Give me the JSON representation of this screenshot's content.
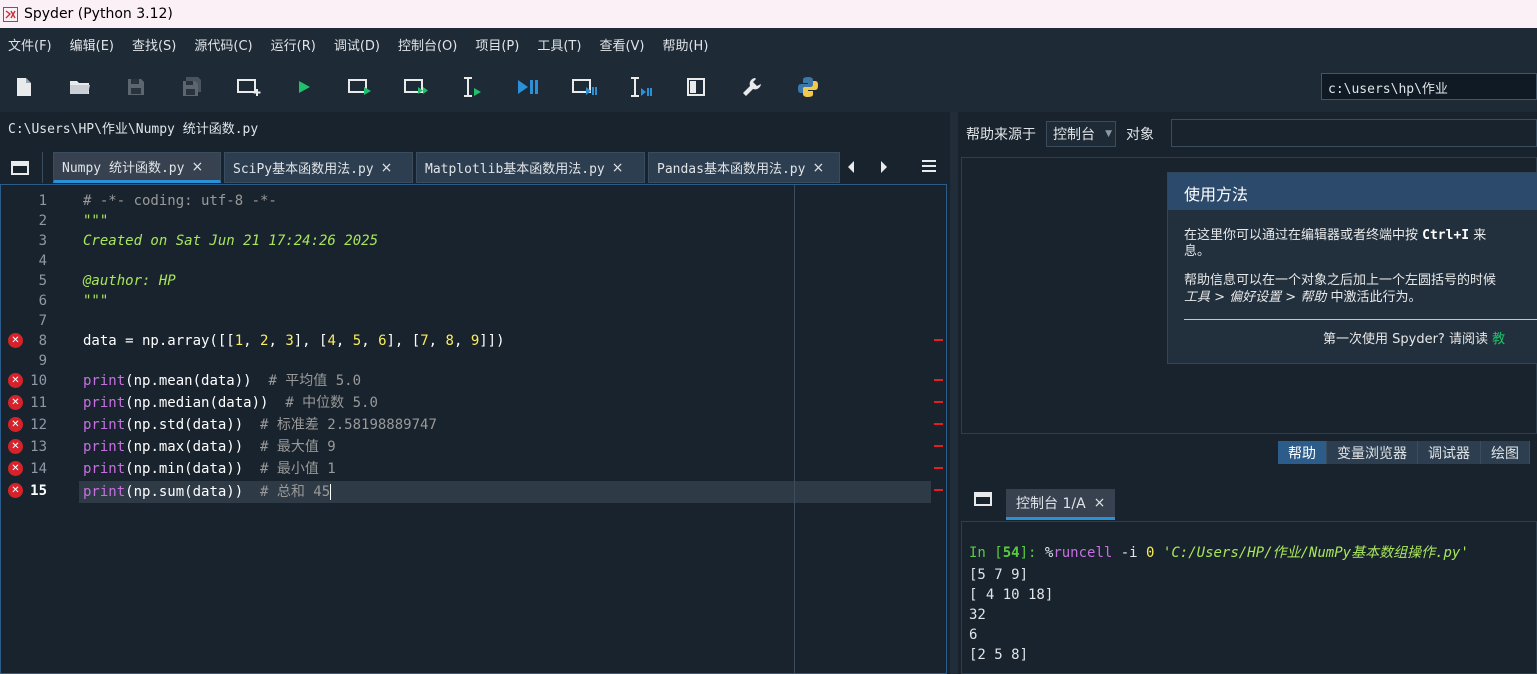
{
  "window": {
    "title": "Spyder (Python 3.12)"
  },
  "menu": [
    "文件(F)",
    "编辑(E)",
    "查找(S)",
    "源代码(C)",
    "运行(R)",
    "调试(D)",
    "控制台(O)",
    "项目(P)",
    "工具(T)",
    "查看(V)",
    "帮助(H)"
  ],
  "toolbar": {
    "icons": [
      "new-file-icon",
      "open-folder-icon",
      "save-icon",
      "save-all-icon",
      "new-cell-icon",
      "run-icon",
      "run-cell-icon",
      "run-cell-advance-icon",
      "run-selection-icon",
      "debug-icon",
      "debug-cell-icon",
      "debug-selection-icon",
      "maximize-pane-icon",
      "preferences-wrench-icon",
      "python-path-icon"
    ],
    "cwd": "c:\\users\\hp\\作业"
  },
  "editor": {
    "filepath": "C:\\Users\\HP\\作业\\Numpy 统计函数.py",
    "tabs": [
      "Numpy 统计函数.py",
      "SciPy基本函数用法.py",
      "Matplotlib基本函数用法.py",
      "Pandas基本函数用法.py"
    ],
    "line_numbers": [
      "1",
      "2",
      "3",
      "4",
      "5",
      "6",
      "7",
      "8",
      "9",
      "10",
      "11",
      "12",
      "13",
      "14",
      "15"
    ],
    "lines": {
      "l1": "# -*- coding: utf-8 -*-",
      "l2": "\"\"\"",
      "l3": "Created on Sat Jun 21 17:24:26 2025",
      "l5": "@author: HP",
      "l6": "\"\"\"",
      "l8_a": "data = np.array([[",
      "l8_n1": "1",
      "l8_s1": ", ",
      "l8_n2": "2",
      "l8_s2": ", ",
      "l8_n3": "3",
      "l8_s3": "], [",
      "l8_n4": "4",
      "l8_s4": ", ",
      "l8_n5": "5",
      "l8_s5": ", ",
      "l8_n6": "6",
      "l8_s6": "], [",
      "l8_n7": "7",
      "l8_s7": ", ",
      "l8_n8": "8",
      "l8_s8": ", ",
      "l8_n9": "9",
      "l8_s9": "]])",
      "print_kw": "print",
      "l10_code": "(np.mean(data))  ",
      "l10_com": "# 平均值 5.0",
      "l11_code": "(np.median(data))  ",
      "l11_com": "# 中位数 5.0",
      "l12_code": "(np.std(data))  ",
      "l12_com": "# 标准差 2.58198889747",
      "l13_code": "(np.max(data))  ",
      "l13_com": "# 最大值 9",
      "l14_code": "(np.min(data))  ",
      "l14_com": "# 最小值 1",
      "l15_code": "(np.sum(data))  ",
      "l15_com": "# 总和 45"
    }
  },
  "help": {
    "source_label": "帮助来源于",
    "source_value": "控制台",
    "object_label": "对象",
    "card_title": "使用方法",
    "p1_a": "在这里你可以通过在编辑器或者终端中按 ",
    "p1_key": "Ctrl+I",
    "p1_b": " 来",
    "p1_c": "息。",
    "p2_a": "帮助信息可以在一个对象之后加上一个左圆括号的时候",
    "p2_i": "工具 > 偏好设置 > 帮助",
    "p2_b": " 中激活此行为。",
    "footer_a": "第一次使用 Spyder? 请阅读 ",
    "footer_link": "教",
    "tabs": [
      "帮助",
      "变量浏览器",
      "调试器",
      "绘图"
    ]
  },
  "console": {
    "tab_label": "控制台 1/A",
    "prompt_in": "In [",
    "prompt_num": "54",
    "prompt_end": "]: ",
    "magic_pct": "%",
    "magic": "runcell",
    "cmd_mid": " -i ",
    "cmd_zero": "0",
    "cmd_sp": " ",
    "cmd_path": "'C:/Users/HP/作业/NumPy基本数组操作.py'",
    "outputs": [
      "[5 7 9]",
      "[ 4 10 18]",
      "32",
      "6",
      "[2 5 8]"
    ]
  },
  "colors": {
    "accent": "#2b91d6",
    "error": "#d6222b",
    "background": "#19232d"
  }
}
